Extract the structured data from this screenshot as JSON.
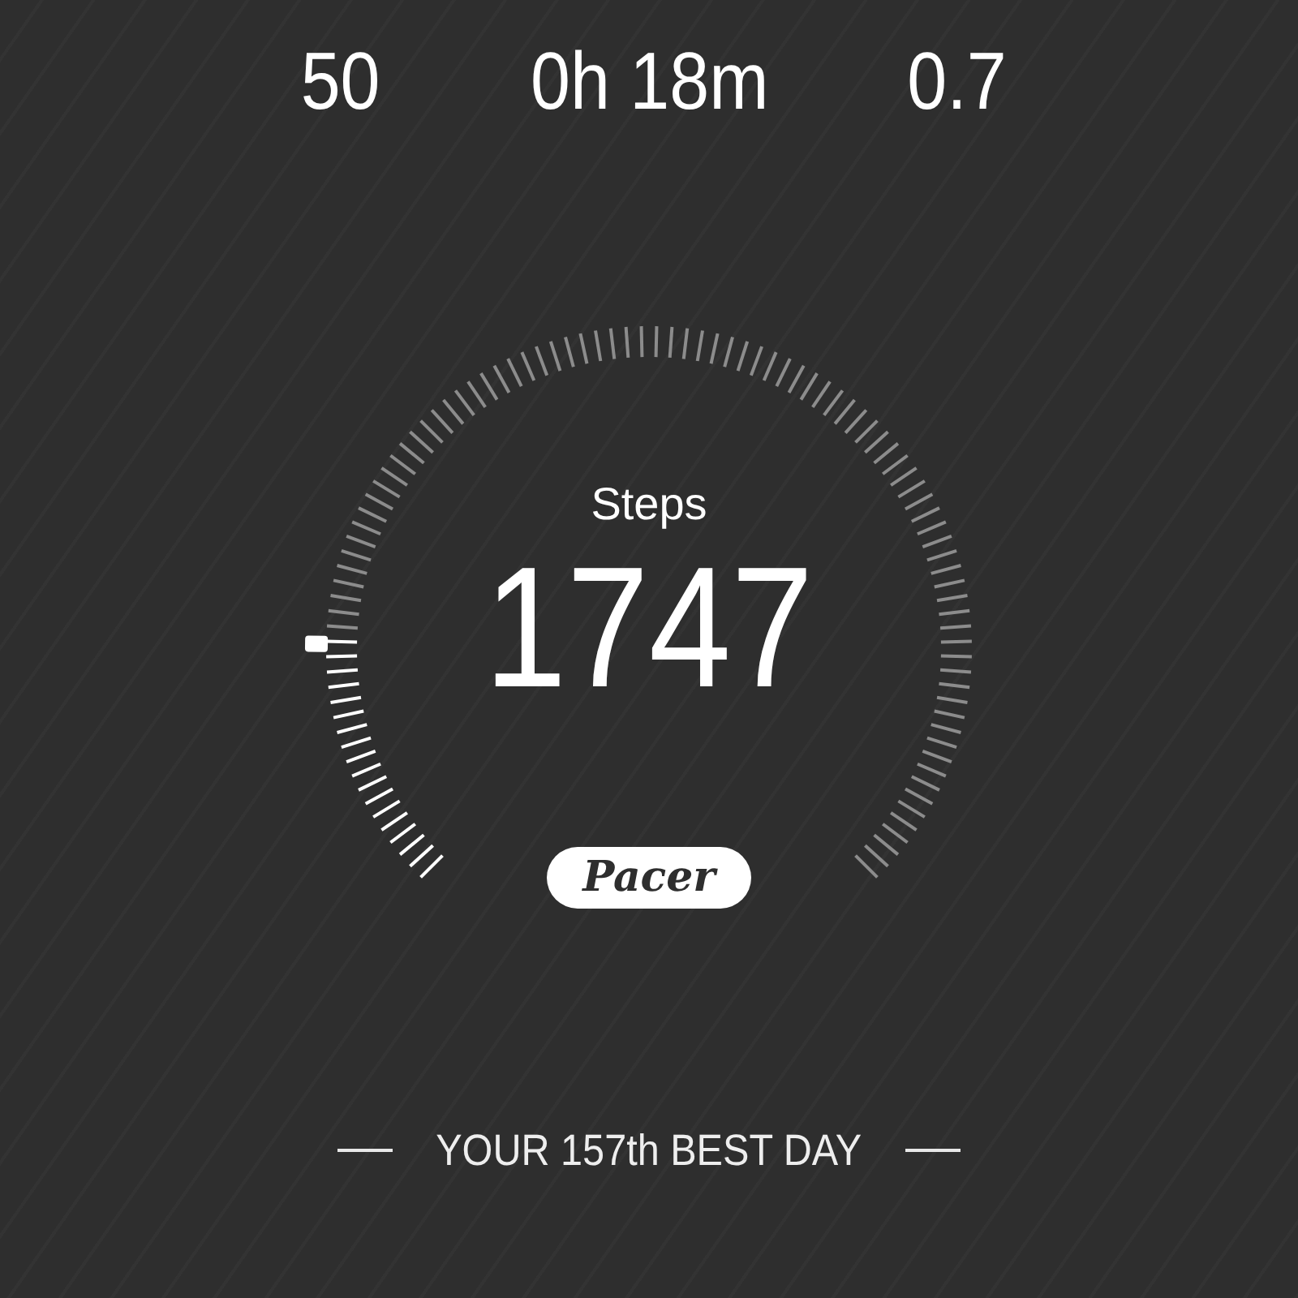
{
  "stats": [
    {
      "value": "50"
    },
    {
      "value": "0h 18m"
    },
    {
      "value": "0.7"
    }
  ],
  "steps": {
    "label": "Steps",
    "value": "1747"
  },
  "brand": "Pacer",
  "rank": "YOUR 157th BEST DAY"
}
